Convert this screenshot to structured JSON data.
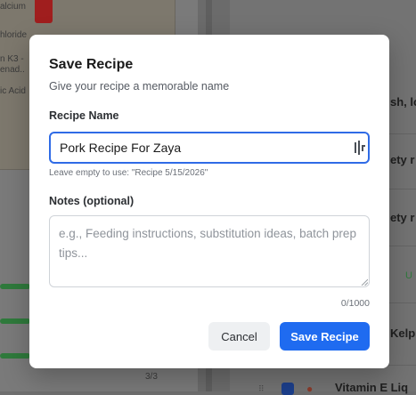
{
  "background": {
    "nutrient_labels": [
      "alcium",
      "hloride",
      "n K3 -",
      "enad..",
      "ic Acid"
    ],
    "set_count": "3/3",
    "right_snippets": [
      "sh, lo",
      "ety r",
      "ety r",
      "U",
      "Kelp",
      "Vitamin E Liq"
    ]
  },
  "modal": {
    "title": "Save Recipe",
    "subtitle": "Give your recipe a memorable name",
    "name_label": "Recipe Name",
    "name_value": "Pork Recipe For Zaya",
    "name_hint": "Leave empty to use: \"Recipe 5/15/2026\"",
    "notes_label": "Notes (optional)",
    "notes_value": "",
    "notes_placeholder": "e.g., Feeding instructions, substitution ideas, batch prep tips...",
    "notes_counter": "0/1000",
    "cancel_label": "Cancel",
    "save_label": "Save Recipe"
  },
  "colors": {
    "accent": "#1f6bf0",
    "focus_border": "#2f6be6",
    "overlay": "#6f6f6f"
  }
}
